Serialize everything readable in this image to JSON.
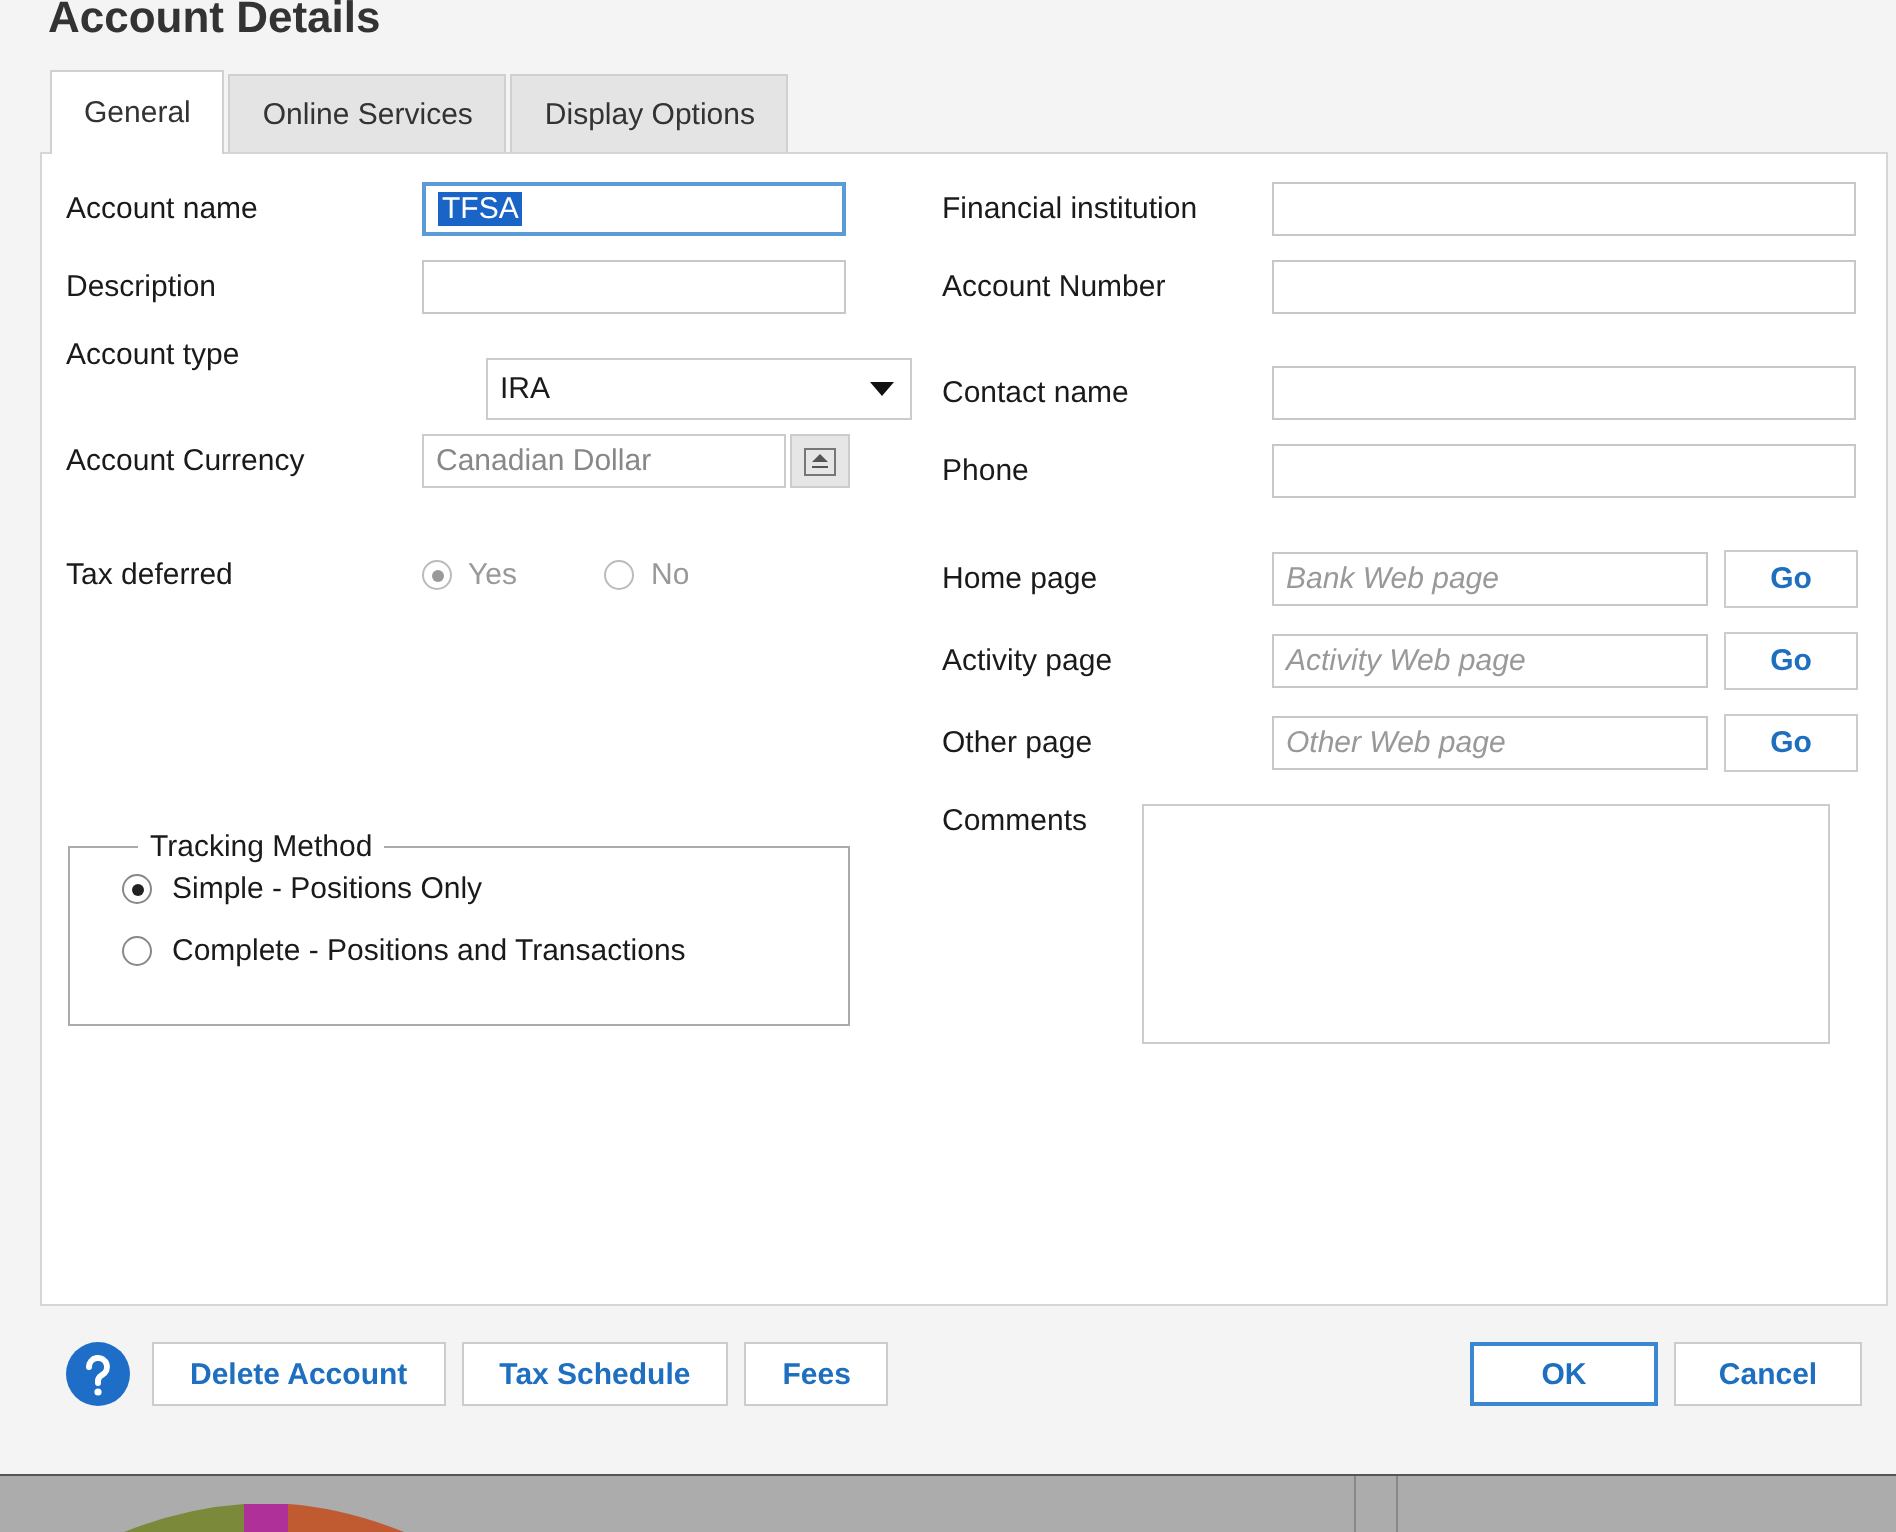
{
  "window": {
    "title": "Account Details"
  },
  "tabs": [
    {
      "label": "General",
      "selected": true
    },
    {
      "label": "Online Services",
      "selected": false
    },
    {
      "label": "Display Options",
      "selected": false
    }
  ],
  "left_fields": [
    {
      "kind": "text",
      "label": "Account name",
      "value": "TFSA",
      "focused": true
    },
    {
      "kind": "text",
      "label": "Description"
    },
    {
      "kind": "select",
      "label": "Account type",
      "value": "IRA"
    },
    {
      "kind": "currency",
      "label": "Account Currency",
      "value": "Canadian Dollar",
      "disabled": true
    },
    {
      "kind": "radio",
      "label": "Tax deferred",
      "options": [
        {
          "label": "Yes",
          "selected": true,
          "disabled": true
        },
        {
          "label": "No",
          "selected": false,
          "disabled": true
        }
      ]
    }
  ],
  "tracking_method": {
    "title": "Tracking Method",
    "options": [
      {
        "label": "Simple - Positions Only",
        "selected": true
      },
      {
        "label": "Complete - Positions and Transactions",
        "selected": false
      }
    ]
  },
  "right_fields": [
    {
      "kind": "text",
      "label": "Financial institution"
    },
    {
      "kind": "text",
      "label": "Account Number"
    },
    {
      "kind": "text",
      "label": "Contact name"
    },
    {
      "kind": "text",
      "label": "Phone"
    },
    {
      "kind": "link",
      "label": "Home page",
      "placeholder": "Bank Web page",
      "button": "Go"
    },
    {
      "kind": "link",
      "label": "Activity page",
      "placeholder": "Activity Web page",
      "button": "Go"
    },
    {
      "kind": "link",
      "label": "Other page",
      "placeholder": "Other Web page",
      "button": "Go"
    },
    {
      "kind": "memo",
      "label": "Comments"
    }
  ],
  "footer_buttons": [
    {
      "label": "Delete Account"
    },
    {
      "label": "Tax Schedule"
    },
    {
      "label": "Fees"
    }
  ],
  "dialog_buttons": [
    {
      "label": "OK",
      "default": true
    },
    {
      "label": "Cancel",
      "default": false
    }
  ]
}
